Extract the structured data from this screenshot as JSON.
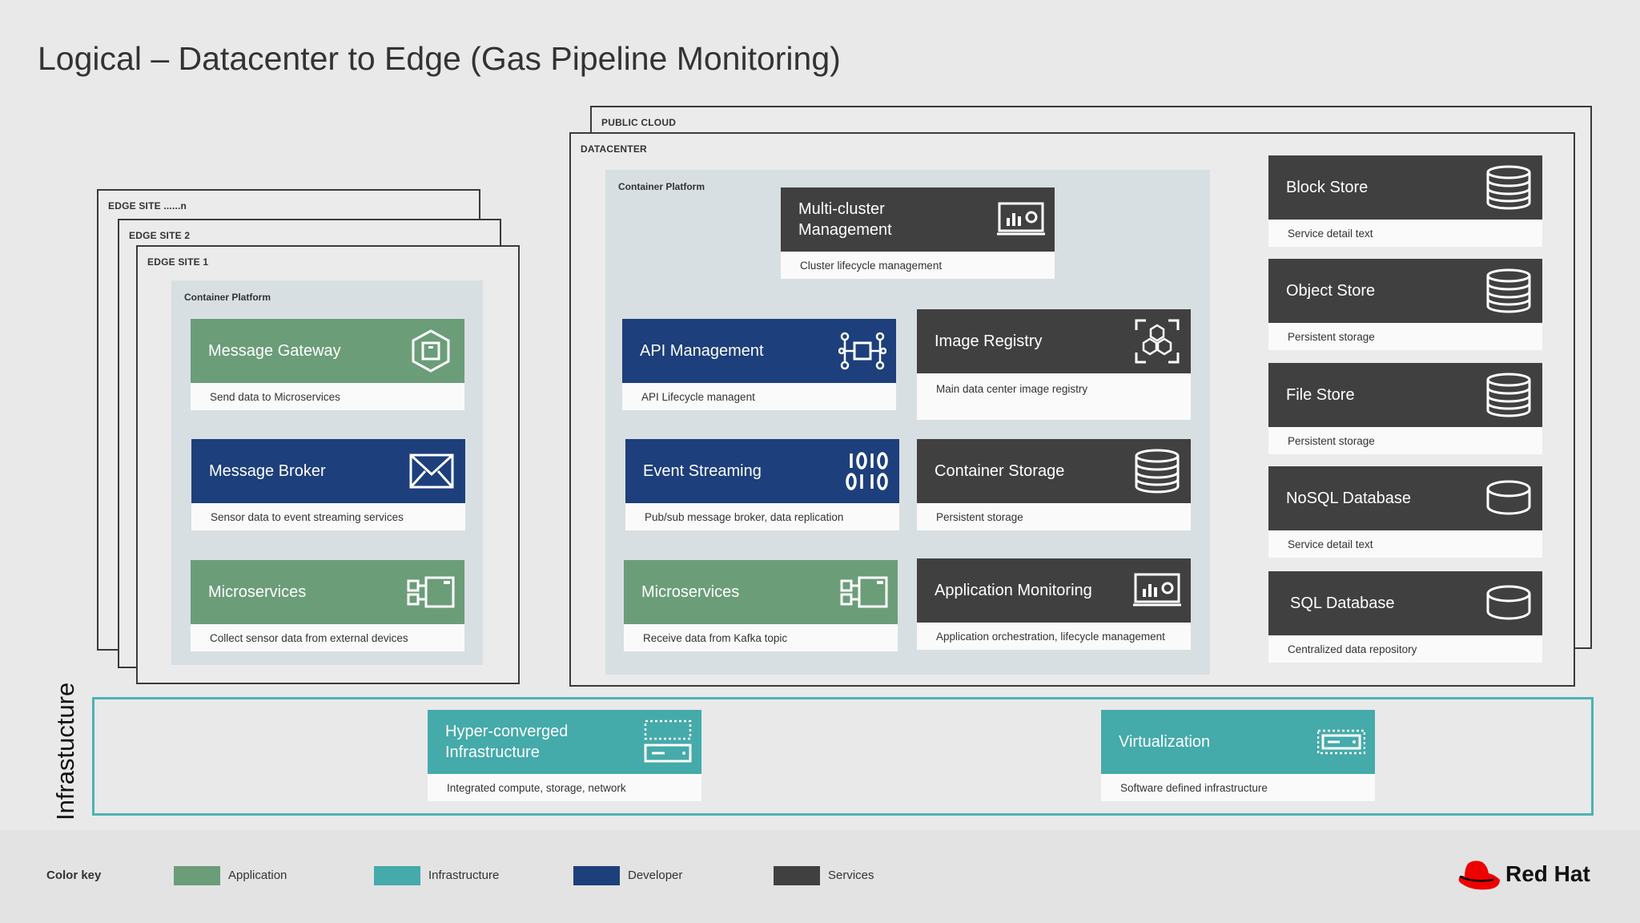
{
  "title": "Logical – Datacenter to Edge (Gas Pipeline Monitoring)",
  "frames": {
    "public_cloud": "PUBLIC CLOUD",
    "datacenter": "DATACENTER",
    "edge_site_n": "EDGE SITE ......n",
    "edge_site_2": "EDGE SITE 2",
    "edge_site_1": "EDGE SITE 1",
    "container_platform": "Container Platform"
  },
  "edge_cards": [
    {
      "title": "Message Gateway",
      "desc": "Send data to Microservices",
      "category": "Application",
      "icon": "hexagon-gateway-icon"
    },
    {
      "title": "Message Broker",
      "desc": "Sensor data to event streaming services",
      "category": "Developer",
      "icon": "envelope-icon"
    },
    {
      "title": "Microservices",
      "desc": "Collect sensor data from external devices",
      "category": "Application",
      "icon": "microservices-icon"
    }
  ],
  "datacenter_cards": {
    "multicluster": {
      "title": "Multi-cluster Management",
      "desc": "Cluster lifecycle management",
      "category": "Services",
      "icon": "monitor-chart-gear-icon"
    },
    "api": {
      "title": "API Management",
      "desc": "API Lifecycle managent",
      "category": "Developer",
      "icon": "api-nodes-icon"
    },
    "image_registry": {
      "title": "Image Registry",
      "desc": "Main data center image registry",
      "category": "Services",
      "icon": "hexagons-registry-icon"
    },
    "event_streaming": {
      "title": "Event Streaming",
      "desc": "Pub/sub message broker, data replication",
      "category": "Developer",
      "icon": "binary-stream-icon"
    },
    "container_storage": {
      "title": "Container Storage",
      "desc": "Persistent storage",
      "category": "Services",
      "icon": "database-icon"
    },
    "microservices": {
      "title": "Microservices",
      "desc": "Receive data from Kafka topic",
      "category": "Application",
      "icon": "microservices-icon"
    },
    "app_monitoring": {
      "title": "Application Monitoring",
      "desc": "Application orchestration, lifecycle management",
      "category": "Services",
      "icon": "monitor-chart-gear-icon"
    }
  },
  "storage_cards": [
    {
      "title": "Block Store",
      "desc": "Service detail text",
      "icon": "database-icon"
    },
    {
      "title": "Object Store",
      "desc": "Persistent storage",
      "icon": "database-icon"
    },
    {
      "title": "File Store",
      "desc": "Persistent storage",
      "icon": "database-icon"
    },
    {
      "title": "NoSQL Database",
      "desc": "Service detail text",
      "icon": "database-flat-icon"
    },
    {
      "title": "SQL Database",
      "desc": "Centralized data repository",
      "icon": "database-flat-icon"
    }
  ],
  "infrastructure": {
    "label": "Infrastucture",
    "cards": [
      {
        "title": "Hyper-converged Infrastructure",
        "desc": "Integrated compute, storage, network",
        "icon": "server-icon"
      },
      {
        "title": "Virtualization",
        "desc": "Software defined infrastructure",
        "icon": "virtual-server-icon"
      }
    ]
  },
  "legend": {
    "title": "Color key",
    "items": [
      {
        "label": "Application",
        "color": "#6b9d79"
      },
      {
        "label": "Infrastructure",
        "color": "#45aaaa"
      },
      {
        "label": "Developer",
        "color": "#1d3f7b"
      },
      {
        "label": "Services",
        "color": "#404040"
      }
    ]
  },
  "logo": {
    "text": "Red Hat",
    "color": "#ee0000"
  }
}
